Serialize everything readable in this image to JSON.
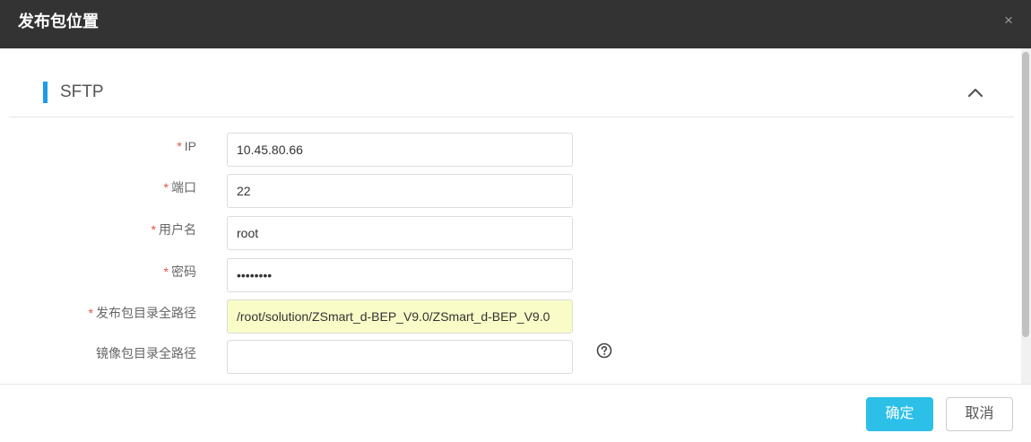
{
  "dialog": {
    "title": "发布包位置",
    "close_glyph": "×"
  },
  "section": {
    "title": "SFTP",
    "collapse_icon": "chevron-up-icon"
  },
  "form": {
    "required_mark": "*",
    "fields": [
      {
        "label": "IP",
        "required": true,
        "value": "10.45.80.66",
        "placeholder": ""
      },
      {
        "label": "端口",
        "required": true,
        "value": "22",
        "placeholder": ""
      },
      {
        "label": "用户名",
        "required": true,
        "value": "root",
        "placeholder": ""
      },
      {
        "label": "密码",
        "required": true,
        "value": "12345678",
        "placeholder": ""
      },
      {
        "label": "发布包目录全路径",
        "required": true,
        "value": "/root/solution/ZSmart_d-BEP_V9.0/ZSmart_d-BEP_V9.0",
        "placeholder": ""
      },
      {
        "label": "镜像包目录全路径",
        "required": false,
        "value": "",
        "placeholder": ""
      }
    ],
    "help_icon": "question-circle-icon"
  },
  "footer": {
    "ok_label": "确定",
    "cancel_label": "取消"
  },
  "colors": {
    "header_bg": "#333333",
    "accent": "#1e9ce8",
    "primary_button": "#2cc0e8",
    "required_star": "#e5514a",
    "autofill_bg": "#fafcc8"
  }
}
